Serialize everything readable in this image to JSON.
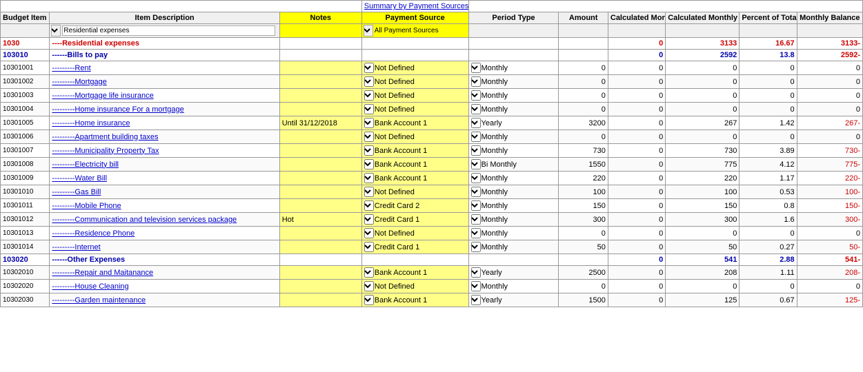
{
  "header": {
    "summary_link": "Summary by Payment Sources",
    "col_budget": "Budget Item Code",
    "col_desc": "Item Description",
    "col_notes": "Notes",
    "col_payment": "Payment Source",
    "col_period": "Period Type",
    "col_amount": "Amount",
    "col_calc_monthly": "Calculated Monthly Income",
    "col_calc_monthly_expense": "Calculated Monthly Expense Greater Than",
    "col_percent": "Percent of Total Expenses",
    "col_monthly_balance": "Monthly Balance"
  },
  "filters": {
    "desc_filter": "Residential expenses",
    "payment_filter": "All Payment Sources"
  },
  "rows": [
    {
      "type": "section",
      "code": "1030",
      "desc": "----Residential expenses",
      "calc_monthly": "0",
      "calc_expense": "3133",
      "percent": "16.67",
      "monthly_balance": "3133-"
    },
    {
      "type": "subsection",
      "code": "103010",
      "desc": "------Bills to pay",
      "calc_monthly": "0",
      "calc_expense": "2592",
      "percent": "13.8",
      "monthly_balance": "2592-"
    },
    {
      "type": "data",
      "code": "10301001",
      "desc": "---------Rent",
      "notes": "",
      "payment": "Not Defined",
      "period": "Monthly",
      "amount": "0",
      "calc_monthly": "0",
      "calc_expense": "0",
      "percent": "0",
      "monthly_balance": "0"
    },
    {
      "type": "data",
      "code": "10301002",
      "desc": "---------Mortgage",
      "notes": "",
      "payment": "Not Defined",
      "period": "Monthly",
      "amount": "0",
      "calc_monthly": "0",
      "calc_expense": "0",
      "percent": "0",
      "monthly_balance": "0"
    },
    {
      "type": "data",
      "code": "10301003",
      "desc": "---------Mortgage life insurance",
      "notes": "",
      "payment": "Not Defined",
      "period": "Monthly",
      "amount": "0",
      "calc_monthly": "0",
      "calc_expense": "0",
      "percent": "0",
      "monthly_balance": "0"
    },
    {
      "type": "data",
      "code": "10301004",
      "desc": "---------Home insurance For a mortgage",
      "notes": "",
      "payment": "Not Defined",
      "period": "Monthly",
      "amount": "0",
      "calc_monthly": "0",
      "calc_expense": "0",
      "percent": "0",
      "monthly_balance": "0"
    },
    {
      "type": "data",
      "code": "10301005",
      "desc": "---------Home insurance",
      "notes": "Until 31/12/2018",
      "payment": "Bank Account 1",
      "period": "Yearly",
      "amount": "3200",
      "calc_monthly": "0",
      "calc_expense": "267",
      "percent": "1.42",
      "monthly_balance": "267-"
    },
    {
      "type": "data",
      "code": "10301006",
      "desc": "---------Apartment building taxes",
      "notes": "",
      "payment": "Not Defined",
      "period": "Monthly",
      "amount": "0",
      "calc_monthly": "0",
      "calc_expense": "0",
      "percent": "0",
      "monthly_balance": "0"
    },
    {
      "type": "data",
      "code": "10301007",
      "desc": "---------Municipality Property Tax",
      "notes": "",
      "payment": "Bank Account 1",
      "period": "Monthly",
      "amount": "730",
      "calc_monthly": "0",
      "calc_expense": "730",
      "percent": "3.89",
      "monthly_balance": "730-"
    },
    {
      "type": "data",
      "code": "10301008",
      "desc": "---------Electricity bill",
      "notes": "",
      "payment": "Bank Account 1",
      "period": "Bi Monthly",
      "amount": "1550",
      "calc_monthly": "0",
      "calc_expense": "775",
      "percent": "4.12",
      "monthly_balance": "775-"
    },
    {
      "type": "data",
      "code": "10301009",
      "desc": "---------Water Bill",
      "notes": "",
      "payment": "Bank Account 1",
      "period": "Monthly",
      "amount": "220",
      "calc_monthly": "0",
      "calc_expense": "220",
      "percent": "1.17",
      "monthly_balance": "220-"
    },
    {
      "type": "data",
      "code": "10301010",
      "desc": "---------Gas Bill",
      "notes": "",
      "payment": "Not Defined",
      "period": "Monthly",
      "amount": "100",
      "calc_monthly": "0",
      "calc_expense": "100",
      "percent": "0.53",
      "monthly_balance": "100-"
    },
    {
      "type": "data",
      "code": "10301011",
      "desc": "---------Mobile Phone",
      "notes": "",
      "payment": "Credit Card 2",
      "period": "Monthly",
      "amount": "150",
      "calc_monthly": "0",
      "calc_expense": "150",
      "percent": "0.8",
      "monthly_balance": "150-"
    },
    {
      "type": "data",
      "code": "10301012",
      "desc": "---------Communication and television services package",
      "notes": "Hot",
      "payment": "Credit Card 1",
      "period": "Monthly",
      "amount": "300",
      "calc_monthly": "0",
      "calc_expense": "300",
      "percent": "1.6",
      "monthly_balance": "300-"
    },
    {
      "type": "data",
      "code": "10301013",
      "desc": "---------Residence Phone",
      "notes": "",
      "payment": "Not Defined",
      "period": "Monthly",
      "amount": "0",
      "calc_monthly": "0",
      "calc_expense": "0",
      "percent": "0",
      "monthly_balance": "0"
    },
    {
      "type": "data",
      "code": "10301014",
      "desc": "---------Internet",
      "notes": "",
      "payment": "Credit Card 1",
      "period": "Monthly",
      "amount": "50",
      "calc_monthly": "0",
      "calc_expense": "50",
      "percent": "0.27",
      "monthly_balance": "50-"
    },
    {
      "type": "subsection",
      "code": "103020",
      "desc": "------Other Expenses",
      "calc_monthly": "0",
      "calc_expense": "541",
      "percent": "2.88",
      "monthly_balance": "541-"
    },
    {
      "type": "data",
      "code": "10302010",
      "desc": "---------Repair and Maitanance",
      "notes": "",
      "payment": "Bank Account 1",
      "period": "Yearly",
      "amount": "2500",
      "calc_monthly": "0",
      "calc_expense": "208",
      "percent": "1.11",
      "monthly_balance": "208-"
    },
    {
      "type": "data",
      "code": "10302020",
      "desc": "---------House Cleaning",
      "notes": "",
      "payment": "Not Defined",
      "period": "Monthly",
      "amount": "0",
      "calc_monthly": "0",
      "calc_expense": "0",
      "percent": "0",
      "monthly_balance": "0"
    },
    {
      "type": "data",
      "code": "10302030",
      "desc": "---------Garden maintenance",
      "notes": "",
      "payment": "Bank Account 1",
      "period": "Yearly",
      "amount": "1500",
      "calc_monthly": "0",
      "calc_expense": "125",
      "percent": "0.67",
      "monthly_balance": "125-"
    }
  ]
}
